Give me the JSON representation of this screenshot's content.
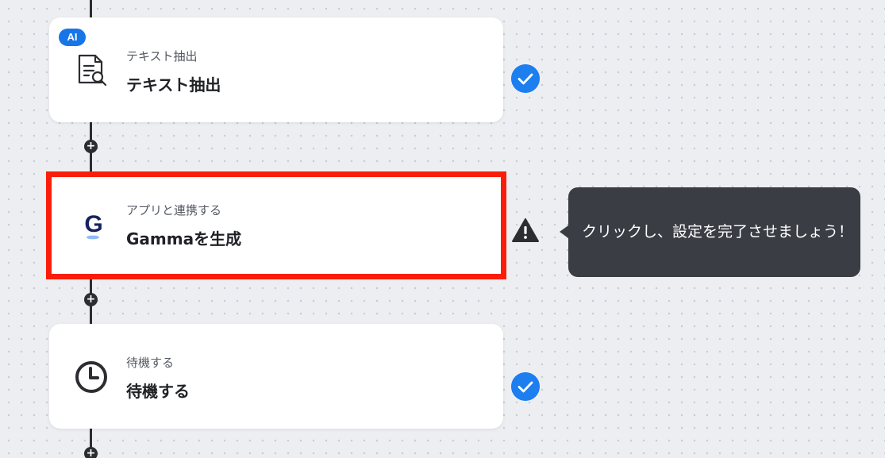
{
  "steps": [
    {
      "badge": "AI",
      "subtitle": "テキスト抽出",
      "title": "テキスト抽出",
      "icon": "document-search-icon",
      "status": "complete"
    },
    {
      "subtitle": "アプリと連携する",
      "title": "Gammaを生成",
      "icon": "gamma-logo-icon",
      "status": "warning",
      "logo_letter": "G"
    },
    {
      "subtitle": "待機する",
      "title": "待機する",
      "icon": "clock-icon",
      "status": "complete"
    }
  ],
  "tooltip": {
    "text": "クリックし、設定を完了させましょう！"
  },
  "add_button_symbol": "+",
  "colors": {
    "accent": "#1d7ef0",
    "highlight": "#fa1e0a",
    "tooltip_bg": "#3a3d43",
    "connector": "#2b2d31"
  }
}
